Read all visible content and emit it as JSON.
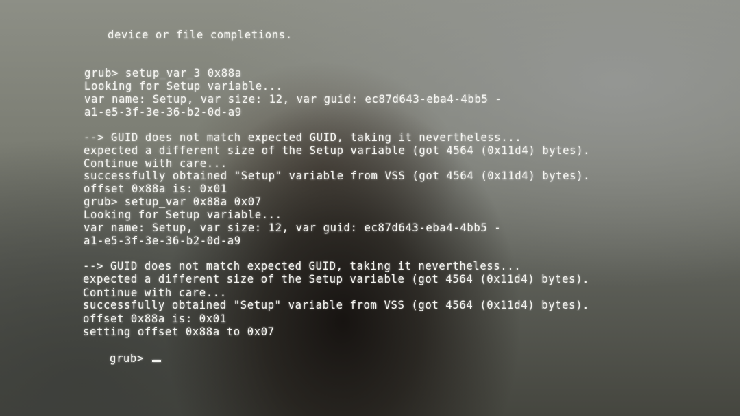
{
  "terminal": {
    "lines": [
      "device or file completions.",
      "grub> setup_var_3 0x88a",
      "Looking for Setup variable...",
      "var name: Setup, var size: 12, var guid: ec87d643-eba4-4bb5 -",
      "a1-e5-3f-3e-36-b2-0d-a9",
      "--> GUID does not match expected GUID, taking it nevertheless...",
      "expected a different size of the Setup variable (got 4564 (0x11d4) bytes).",
      "Continue with care...",
      "successfully obtained \"Setup\" variable from VSS (got 4564 (0x11d4) bytes).",
      "offset 0x88a is: 0x01",
      "grub> setup_var 0x88a 0x07",
      "Looking for Setup variable...",
      "var name: Setup, var size: 12, var guid: ec87d643-eba4-4bb5 -",
      "a1-e5-3f-3e-36-b2-0d-a9",
      "--> GUID does not match expected GUID, taking it nevertheless...",
      "expected a different size of the Setup variable (got 4564 (0x11d4) bytes).",
      "Continue with care...",
      "successfully obtained \"Setup\" variable from VSS (got 4564 (0x11d4) bytes).",
      "offset 0x88a is: 0x01",
      "setting offset 0x88a to 0x07",
      "grub> "
    ]
  },
  "colors": {
    "text": "#f4f4f0"
  }
}
